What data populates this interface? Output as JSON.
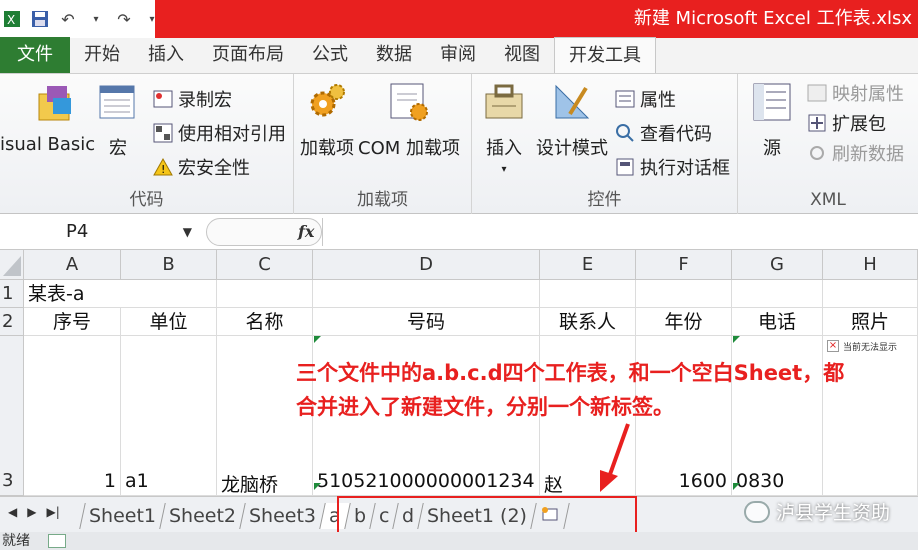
{
  "window": {
    "title": "新建 Microsoft Excel 工作表.xlsx",
    "qat_icons": [
      "excel-app-icon",
      "save-icon",
      "undo-icon",
      "redo-icon",
      "customize-qat-icon"
    ]
  },
  "tabs": [
    {
      "label": "文件"
    },
    {
      "label": "开始"
    },
    {
      "label": "插入"
    },
    {
      "label": "页面布局"
    },
    {
      "label": "公式"
    },
    {
      "label": "数据"
    },
    {
      "label": "审阅"
    },
    {
      "label": "视图"
    },
    {
      "label": "开发工具"
    }
  ],
  "ribbon": {
    "code": {
      "label": "代码",
      "visual_basic": "isual Basic",
      "macros": "宏",
      "record_macro": "录制宏",
      "relative_ref": "使用相对引用",
      "macro_security": "宏安全性"
    },
    "addins": {
      "label": "加载项",
      "addins_btn": "加载项",
      "com_addins": "COM 加载项"
    },
    "controls": {
      "label": "控件",
      "insert": "插入",
      "design_mode": "设计模式",
      "properties": "属性",
      "view_code": "查看代码",
      "run_dialog": "执行对话框"
    },
    "xml": {
      "label": "XML",
      "source": "源",
      "map_properties": "映射属性",
      "expansion_packs": "扩展包",
      "refresh_data": "刷新数据"
    }
  },
  "formula_bar": {
    "name_box": "P4",
    "fx": "fx",
    "value": ""
  },
  "grid": {
    "columns": [
      "A",
      "B",
      "C",
      "D",
      "E",
      "F",
      "G",
      "H"
    ],
    "rows": [
      "1",
      "2",
      "3"
    ],
    "cells": {
      "a1": "某表-a",
      "a2": "序号",
      "b2": "单位",
      "c2": "名称",
      "d2": "号码",
      "e2": "联系人",
      "f2": "年份",
      "g2": "电话",
      "h2": "照片",
      "a3": "1",
      "b3": "a1",
      "c3": "龙脑桥",
      "d3": "510521000000001234",
      "e3": "赵",
      "f3": "1600",
      "g3": "0830"
    },
    "photo_placeholder": "当前无法显示"
  },
  "annotation": {
    "line1": "三个文件中的a.b.c.d四个工作表，和一个空白Sheet，都",
    "line2": "合并进入了新建文件，分别一个新标签。",
    "color": "#e8201f"
  },
  "sheet_tabs": [
    "Sheet1",
    "Sheet2",
    "Sheet3",
    "a",
    "b",
    "c",
    "d",
    "Sheet1 (2)"
  ],
  "watermark": "泸县学生资助",
  "status": {
    "text": "就绪"
  }
}
